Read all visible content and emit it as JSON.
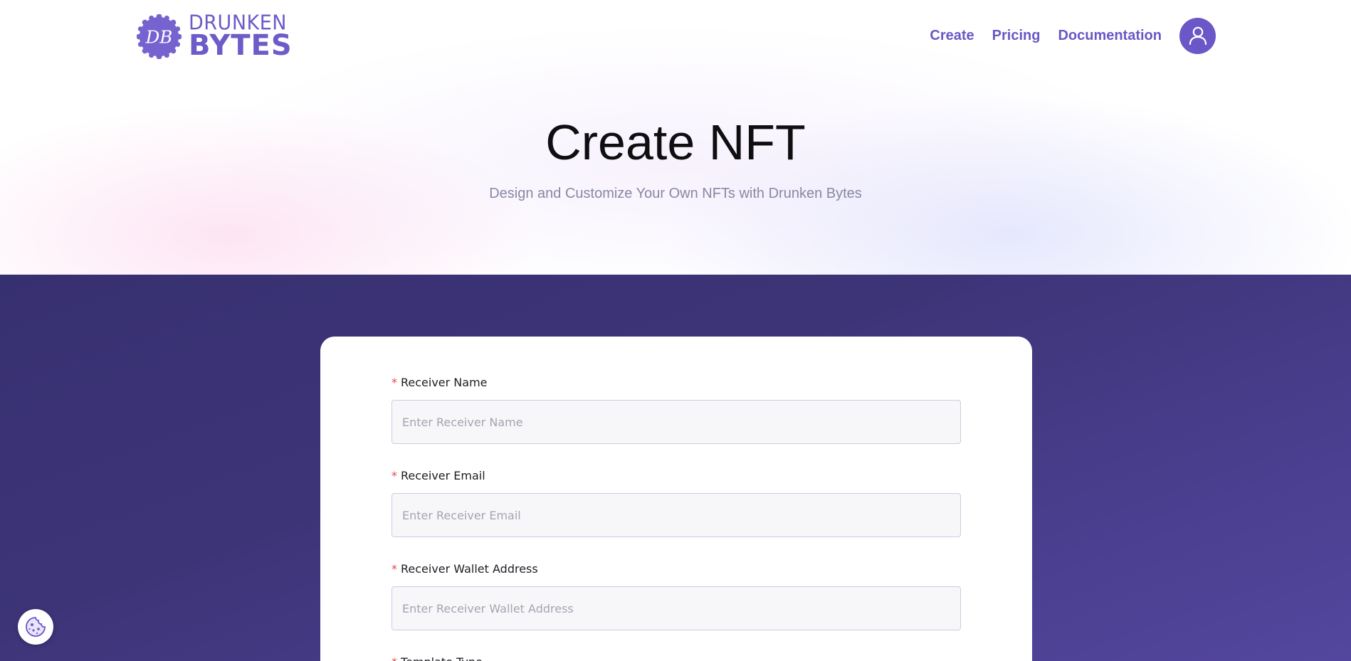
{
  "brand": {
    "badge_text": "DB",
    "line1": "DRUNKEN",
    "line2": "BYTES",
    "color": "#6c5bc8"
  },
  "nav": {
    "items": [
      {
        "label": "Create"
      },
      {
        "label": "Pricing"
      },
      {
        "label": "Documentation"
      }
    ],
    "accent": "#6a58c6",
    "avatar_icon": "user-icon"
  },
  "hero": {
    "title": "Create NFT",
    "subtitle": "Design and Customize Your Own NFTs with Drunken Bytes"
  },
  "form": {
    "required_mark": "*",
    "fields": [
      {
        "label": "Receiver Name",
        "placeholder": "Enter Receiver Name",
        "value": ""
      },
      {
        "label": "Receiver Email",
        "placeholder": "Enter Receiver Email",
        "value": ""
      },
      {
        "label": "Receiver Wallet Address",
        "placeholder": "Enter Receiver Wallet Address",
        "value": ""
      },
      {
        "label": "Template Type"
      }
    ]
  },
  "colors": {
    "section_bg": "#3d3478",
    "required": "#e5484d"
  },
  "cookie_icon": "cookie-icon"
}
